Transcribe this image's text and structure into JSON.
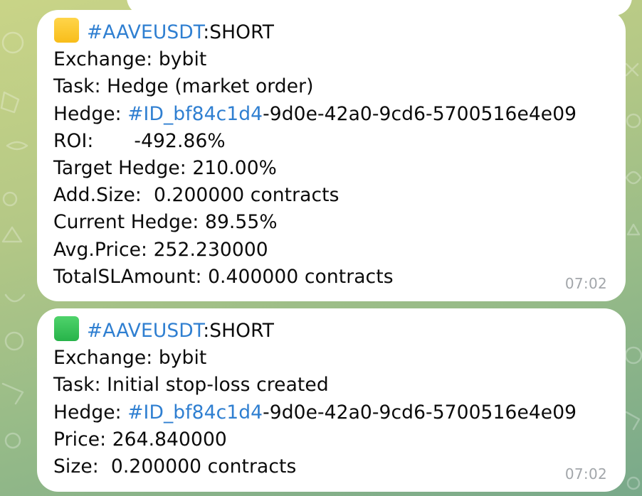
{
  "messages": [
    {
      "status_color": "#f8c630",
      "hashtag": "#AAVEUSDT",
      "side": ":SHORT",
      "exchange": "Exchange: bybit",
      "task": "Task: Hedge (market order)",
      "hedge_prefix": "Hedge: ",
      "hedge_tag": "#ID_bf84c1d4",
      "hedge_suffix": "-9d0e-42a0-9cd6-5700516e4e09",
      "roi_label": "ROI:",
      "roi_value": "-492.86%",
      "target_hedge": "Target Hedge: 210.00%",
      "add_size": "Add.Size:  0.200000 contracts",
      "current_hedge": "Current Hedge: 89.55%",
      "avg_price": "Avg.Price: 252.230000",
      "total_sl": "TotalSLAmount: 0.400000 contracts",
      "time": "07:02"
    },
    {
      "status_color": "#2fbf52",
      "hashtag": "#AAVEUSDT",
      "side": ":SHORT",
      "exchange": "Exchange: bybit",
      "task": "Task: Initial stop-loss created",
      "hedge_prefix": "Hedge: ",
      "hedge_tag": "#ID_bf84c1d4",
      "hedge_suffix": "-9d0e-42a0-9cd6-5700516e4e09",
      "price": "Price: 264.840000",
      "size": "Size:  0.200000 contracts",
      "time": "07:02"
    }
  ]
}
